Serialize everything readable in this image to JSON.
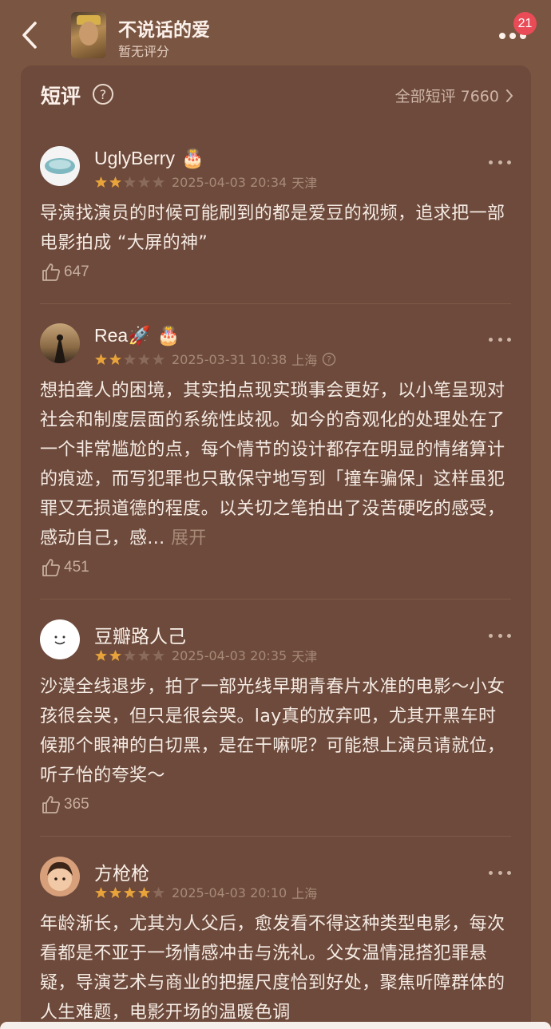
{
  "header": {
    "movie_title": "不说话的爱",
    "movie_sub": "暂无评分",
    "notification_count": "21"
  },
  "section": {
    "title": "短评",
    "all_link": "全部短评 7660"
  },
  "reviews": [
    {
      "username": "UglyBerry",
      "stars": 2,
      "datetime": "2025-04-03 20:34",
      "location": "天津",
      "text": "导演找演员的时候可能刷到的都是爱豆的视频，追求把一部电影拍成 “大屏的神”",
      "expand": "",
      "likes": "647"
    },
    {
      "username": "Rea🚀",
      "stars": 2,
      "datetime": "2025-03-31 10:38",
      "location": "上海",
      "text": "想拍聋人的困境，其实拍点现实琐事会更好，以小笔呈现对社会和制度层面的系统性歧视。如今的奇观化的处理处在了一个非常尴尬的点，每个情节的设计都存在明显的情绪算计的痕迹，而写犯罪也只敢保守地写到「撞车骗保」这样虽犯罪又无损道德的程度。以关切之笔拍出了没苦硬吃的感受，感动自己，感...",
      "expand": "展开",
      "likes": "451"
    },
    {
      "username": "豆瓣路人己",
      "stars": 2,
      "datetime": "2025-04-03 20:35",
      "location": "天津",
      "text": "沙漠全线退步，拍了一部光线早期青春片水准的电影～小女孩很会哭，但只是很会哭。lay真的放弃吧，尤其开黑车时候那个眼神的白切黑，是在干嘛呢？可能想上演员请就位，听子怡的夸奖～",
      "expand": "",
      "likes": "365"
    },
    {
      "username": "方枪枪",
      "stars": 4,
      "datetime": "2025-04-03 20:10",
      "location": "上海",
      "text": "年龄渐长，尤其为人父后，愈发看不得这种类型电影，每次看都是不亚于一场情感冲击与洗礼。父女温情混搭犯罪悬疑，导演艺术与商业的把握尺度恰到好处，聚焦听障群体的人生难题，电影开场的温暖色调",
      "expand": "",
      "likes": ""
    }
  ],
  "colors": {
    "background": "#7a5542",
    "card": "#6d4a3b",
    "star_on": "#e8a33a",
    "star_off": "#8a6a5a",
    "badge": "#e94b57"
  }
}
